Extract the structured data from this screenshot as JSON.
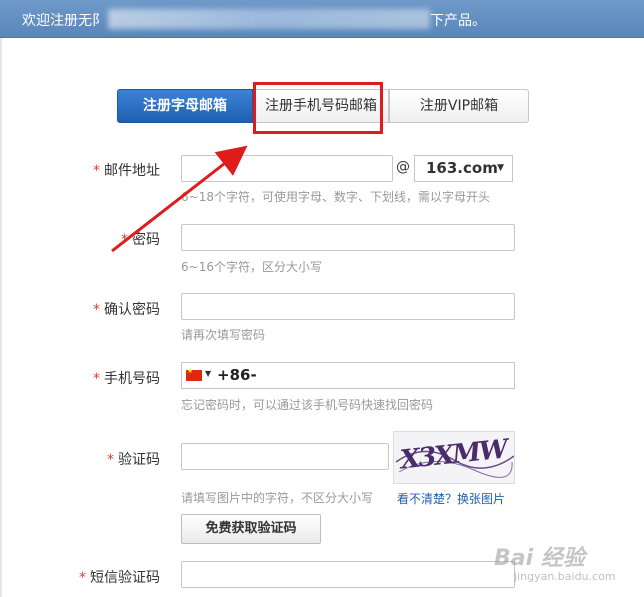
{
  "header": {
    "welcome_prefix": "欢迎注册无阝",
    "welcome_suffix": "下产品。"
  },
  "tabs": [
    {
      "label": "注册字母邮箱",
      "active": true
    },
    {
      "label": "注册手机号码邮箱",
      "active": false
    },
    {
      "label": "注册VIP邮箱",
      "active": false
    }
  ],
  "form": {
    "email": {
      "label": "邮件地址",
      "value": "",
      "at": "@",
      "domain": "163.com",
      "hint": "6~18个字符，可使用字母、数字、下划线，需以字母开头"
    },
    "password": {
      "label": "密码",
      "value": "",
      "hint": "6~16个字符，区分大小写"
    },
    "confirm_password": {
      "label": "确认密码",
      "value": "",
      "hint": "请再次填写密码"
    },
    "phone": {
      "label": "手机号码",
      "prefix": "+86-",
      "hint": "忘记密码时，可以通过该手机号码快速找回密码"
    },
    "captcha": {
      "label": "验证码",
      "value": "",
      "image_text": "X3XMW",
      "hint": "请填写图片中的字符，不区分大小写",
      "refresh_link": "看不清楚？换张图片"
    },
    "get_code_button": "免费获取验证码",
    "sms_code": {
      "label": "短信验证码",
      "value": ""
    }
  },
  "watermark": {
    "text": "Bai 经验",
    "url": "jingyan.baidu.com"
  },
  "colors": {
    "header_blue": "#5a86ba",
    "active_tab": "#1f5fb0",
    "annotation_red": "#e01b1b",
    "required_star": "#e23b3b"
  }
}
